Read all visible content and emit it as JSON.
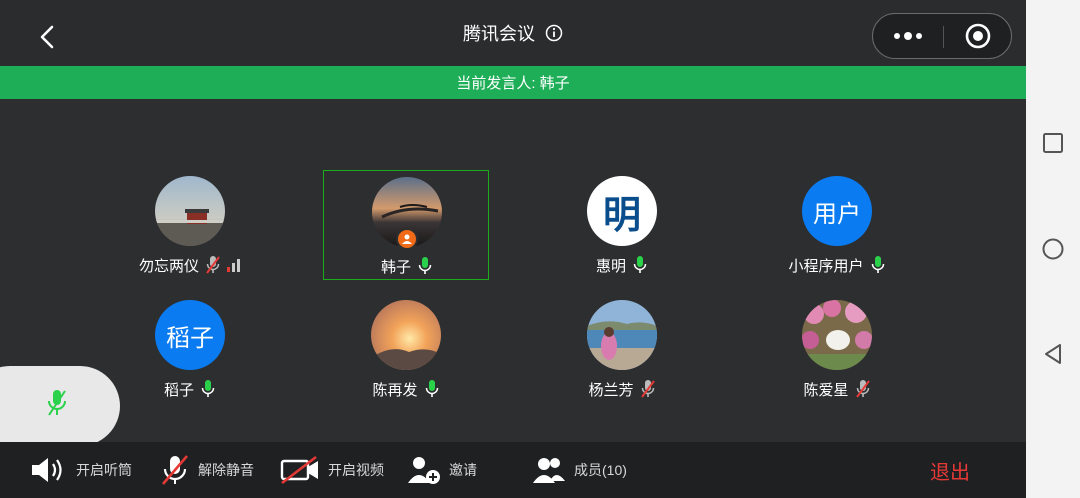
{
  "header": {
    "title": "腾讯会议"
  },
  "banner": {
    "text": "当前发言人: 韩子"
  },
  "participants": [
    {
      "name": "勿忘两仪",
      "avatar_type": "photo",
      "mic": "muted",
      "signal": true
    },
    {
      "name": "韩子",
      "avatar_type": "photo",
      "mic": "on",
      "host": true,
      "active": true
    },
    {
      "name": "惠明",
      "avatar_type": "text",
      "avatar_text": "明",
      "mic": "on"
    },
    {
      "name": "小程序用户",
      "avatar_type": "text",
      "avatar_text": "用户",
      "mic": "on"
    },
    {
      "name": "稻子",
      "avatar_type": "text",
      "avatar_text": "稻子",
      "mic": "on"
    },
    {
      "name": "陈再发",
      "avatar_type": "photo",
      "mic": "on"
    },
    {
      "name": "杨兰芳",
      "avatar_type": "photo",
      "mic": "muted"
    },
    {
      "name": "陈爱星",
      "avatar_type": "photo",
      "mic": "muted"
    }
  ],
  "toolbar": {
    "speaker_label": "开启听筒",
    "unmute_label": "解除静音",
    "video_label": "开启视频",
    "invite_label": "邀请",
    "members_label": "成员(10)",
    "exit_label": "退出"
  },
  "colors": {
    "banner_green": "#1dae57",
    "mic_green": "#2ad14a",
    "muted_red": "#e53935",
    "avatar_blue": "#0a7bf0",
    "exit_red": "#e53935"
  },
  "icons": {
    "back": "chevron-left-icon",
    "info": "info-icon",
    "more": "more-dots-icon",
    "close": "record-target-icon"
  }
}
